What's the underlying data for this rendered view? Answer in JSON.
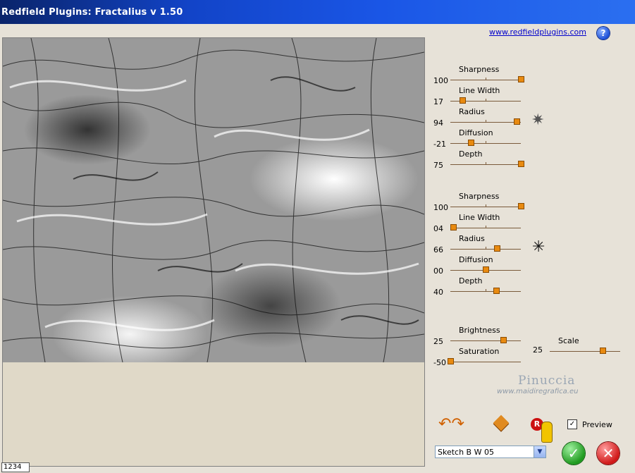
{
  "window": {
    "title": "Redfield Plugins: Fractalius v 1.50"
  },
  "header": {
    "link_text": "www.redfieldplugins.com",
    "help_label": "?"
  },
  "status_field": "1234",
  "group1": {
    "sliders": [
      {
        "label": "Sharpness",
        "value": "100",
        "position": 1.0
      },
      {
        "label": "Line Width",
        "value": "17",
        "position": 0.17
      },
      {
        "label": "Radius",
        "value": "94",
        "position": 0.94
      },
      {
        "label": "Diffusion",
        "value": "-21",
        "position": 0.29
      },
      {
        "label": "Depth",
        "value": "75",
        "position": 1.0
      }
    ]
  },
  "group2": {
    "sliders": [
      {
        "label": "Sharpness",
        "value": "100",
        "position": 1.0
      },
      {
        "label": "Line Width",
        "value": "04",
        "position": 0.04
      },
      {
        "label": "Radius",
        "value": "66",
        "position": 0.66
      },
      {
        "label": "Diffusion",
        "value": "00",
        "position": 0.5
      },
      {
        "label": "Depth",
        "value": "40",
        "position": 0.65
      }
    ]
  },
  "color": {
    "brightness": {
      "label": "Brightness",
      "value": "25",
      "position": 0.75
    },
    "saturation": {
      "label": "Saturation",
      "value": "-50",
      "position": 0.0
    },
    "scale": {
      "label": "Scale",
      "value": "25",
      "position": 0.75
    }
  },
  "watermark": {
    "line1": "Pinuccia",
    "line2": "www.maidiregrafica.eu"
  },
  "preview_checkbox": {
    "label": "Preview",
    "checked": true
  },
  "preset": {
    "selected": "Sketch B W 05"
  },
  "colors": {
    "accent": "#e88a10",
    "titlebar": "#1244c8"
  }
}
